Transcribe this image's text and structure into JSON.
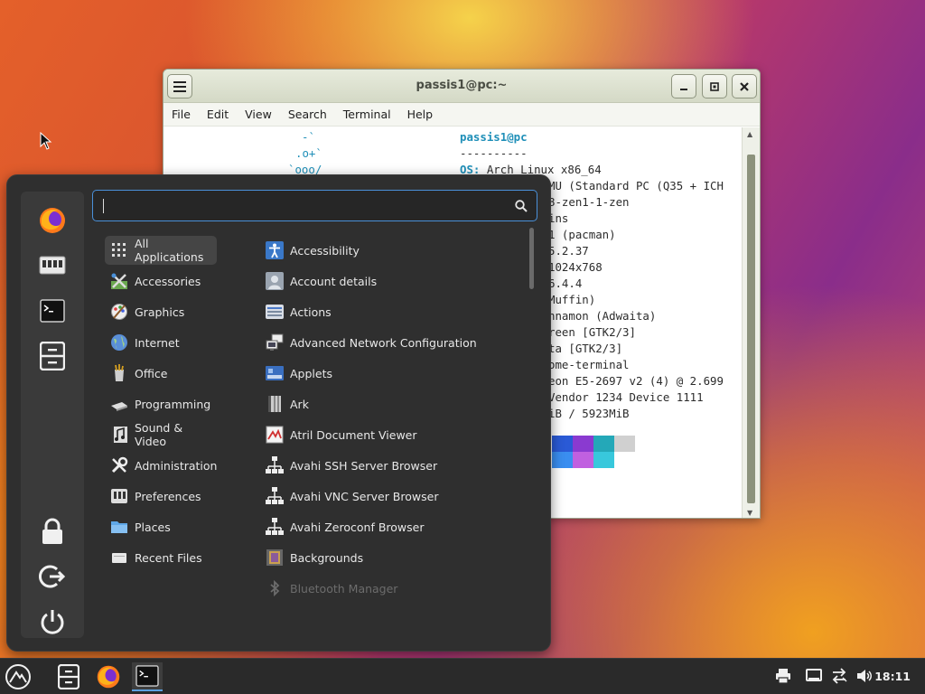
{
  "terminal": {
    "title": "passis1@pc:~",
    "menu": [
      "File",
      "Edit",
      "View",
      "Search",
      "Terminal",
      "Help"
    ],
    "logo_lines": [
      "-`",
      ".o+`",
      "`ooo/"
    ],
    "user_host": "passis1@pc",
    "separator": "----------",
    "info_lines": [
      {
        "key": "OS:",
        "value": " Arch Linux x86_64"
      },
      {
        "key": "",
        "value": "MU (Standard PC (Q35 + ICH"
      },
      {
        "key": "",
        "value": "8-zen1-1-zen"
      },
      {
        "key": "",
        "value": "ins"
      },
      {
        "key": "",
        "value": "1 (pacman)"
      },
      {
        "key": "",
        "value": "5.2.37"
      },
      {
        "key": "",
        "value": "1024x768"
      },
      {
        "key": "",
        "value": "6.4.4"
      },
      {
        "key": "",
        "value": "Muffin)"
      },
      {
        "key": "",
        "value": "nnamon (Adwaita)"
      },
      {
        "key": "",
        "value": "reen [GTK2/3]"
      },
      {
        "key": "",
        "value": "ta [GTK2/3]"
      },
      {
        "key": "",
        "value": "ome-terminal"
      },
      {
        "key": "",
        "value": "eon E5-2697 v2 (4) @ 2.699"
      },
      {
        "key": "",
        "value": "Vendor 1234 Device 1111"
      },
      {
        "key": "",
        "value": "iB / 5923MiB"
      }
    ],
    "swatch_colors_row1": [
      "#2a5ad6",
      "#8a3ad0",
      "#24a8b8",
      "#d0d0d0"
    ],
    "swatch_colors_row2": [
      "#3a8ef0",
      "#c060e0",
      "#38c8dc"
    ]
  },
  "menu": {
    "search": {
      "value": "",
      "placeholder": ""
    },
    "categories": [
      {
        "label": "All Applications",
        "icon": "grid-icon"
      },
      {
        "label": "Accessories",
        "icon": "accessories-icon"
      },
      {
        "label": "Graphics",
        "icon": "graphics-icon"
      },
      {
        "label": "Internet",
        "icon": "globe-icon"
      },
      {
        "label": "Office",
        "icon": "office-icon"
      },
      {
        "label": "Programming",
        "icon": "programming-icon"
      },
      {
        "label": "Sound & Video",
        "icon": "multimedia-icon"
      },
      {
        "label": "Administration",
        "icon": "tools-icon"
      },
      {
        "label": "Preferences",
        "icon": "preferences-icon"
      },
      {
        "label": "Places",
        "icon": "folder-icon"
      },
      {
        "label": "Recent Files",
        "icon": "recent-files-icon"
      }
    ],
    "apps": [
      {
        "label": "Accessibility",
        "icon": "accessibility-icon"
      },
      {
        "label": "Account details",
        "icon": "account-icon"
      },
      {
        "label": "Actions",
        "icon": "actions-icon"
      },
      {
        "label": "Advanced Network Configuration",
        "icon": "network-icon"
      },
      {
        "label": "Applets",
        "icon": "applets-icon"
      },
      {
        "label": "Ark",
        "icon": "ark-icon"
      },
      {
        "label": "Atril Document Viewer",
        "icon": "document-viewer-icon"
      },
      {
        "label": "Avahi SSH Server Browser",
        "icon": "avahi-icon"
      },
      {
        "label": "Avahi VNC Server Browser",
        "icon": "avahi-icon"
      },
      {
        "label": "Avahi Zeroconf Browser",
        "icon": "avahi-icon"
      },
      {
        "label": "Backgrounds",
        "icon": "backgrounds-icon"
      },
      {
        "label": "Bluetooth Manager",
        "icon": "bluetooth-icon"
      }
    ]
  },
  "taskbar": {
    "clock": "18:11"
  },
  "colors": {
    "accent": "#4a90d9",
    "menu_bg": "#2f2f2f",
    "taskbar_bg": "#2a2a2a",
    "terminal_cyan": "#1f8fb8"
  }
}
